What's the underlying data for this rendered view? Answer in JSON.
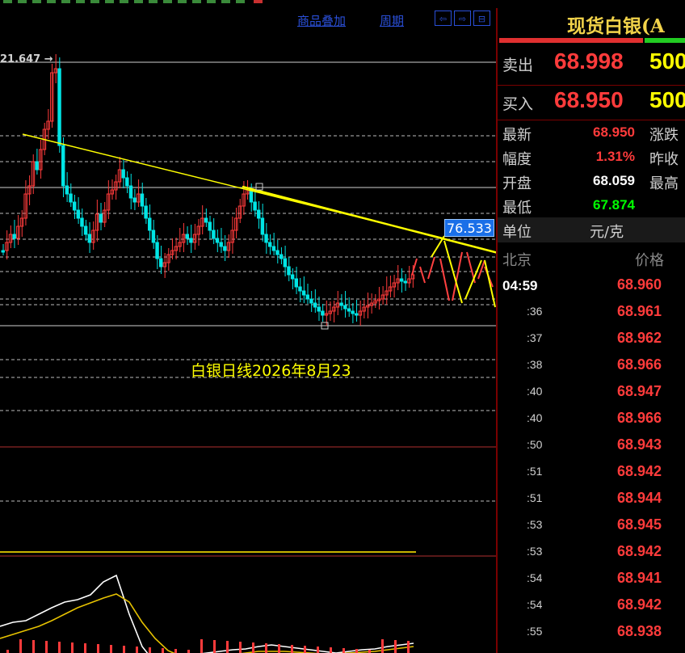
{
  "chart": {
    "high_label": "21.647",
    "target_price": "76.533",
    "annotation": "白银日线2026年8月23",
    "toolbar": {
      "overlay": "商品叠加",
      "period": "周期"
    }
  },
  "panel": {
    "title": "现货白银(A",
    "sell_label": "卖出",
    "sell_price": "68.998",
    "sell_qty": "500",
    "buy_label": "买入",
    "buy_price": "68.950",
    "buy_qty": "500",
    "latest_label": "最新",
    "latest_value": "68.950",
    "change_label": "涨跌",
    "amp_label": "幅度",
    "amp_value": "1.31%",
    "prev_label": "昨收",
    "open_label": "开盘",
    "open_value": "68.059",
    "high_label": "最高",
    "low_label": "最低",
    "low_value": "67.874",
    "unit_label": "单位",
    "unit_value": "元/克",
    "beijing_label": "北京",
    "price_header": "价格",
    "ticks": [
      {
        "time": "04:59",
        "price": "68.960"
      },
      {
        "time": ":36",
        "price": "68.961"
      },
      {
        "time": ":37",
        "price": "68.962"
      },
      {
        "time": ":38",
        "price": "68.966"
      },
      {
        "time": ":40",
        "price": "68.947"
      },
      {
        "time": ":40",
        "price": "68.966"
      },
      {
        "time": ":50",
        "price": "68.943"
      },
      {
        "time": ":51",
        "price": "68.942"
      },
      {
        "time": ":51",
        "price": "68.944"
      },
      {
        "time": ":53",
        "price": "68.945"
      },
      {
        "time": ":53",
        "price": "68.942"
      },
      {
        "time": ":54",
        "price": "68.941"
      },
      {
        "time": ":54",
        "price": "68.942"
      },
      {
        "time": ":55",
        "price": "68.938"
      }
    ]
  },
  "colors": {
    "up": "#ff3b3b",
    "down": "#00e5e5",
    "trendline": "#ffff00",
    "low": "#00ff00"
  }
}
